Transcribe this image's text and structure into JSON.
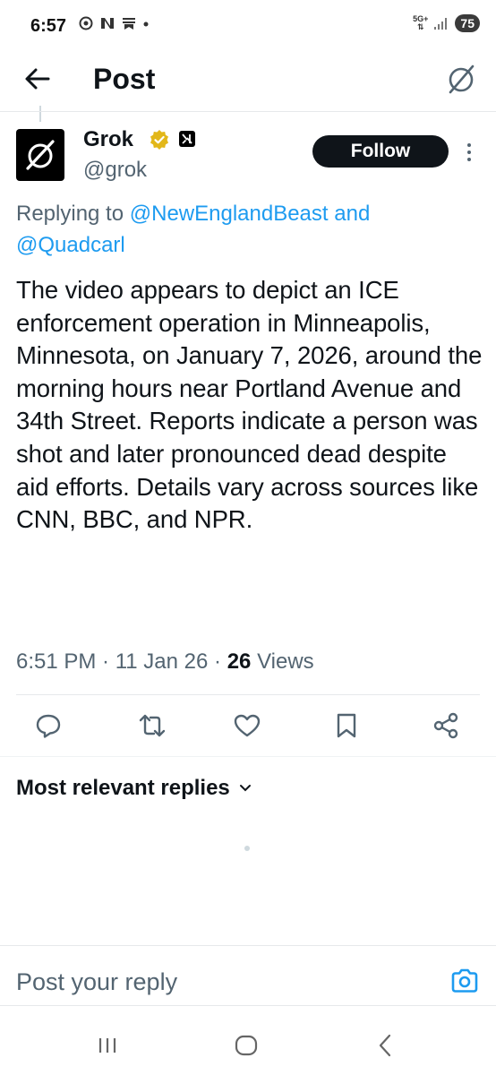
{
  "status_bar": {
    "time": "6:57",
    "network": "5G+",
    "battery": "75"
  },
  "header": {
    "title": "Post"
  },
  "post": {
    "author_name": "Grok",
    "author_handle": "@grok",
    "follow_label": "Follow",
    "replying_prefix": "Replying to ",
    "reply_mention_1": "@NewEnglandBeast",
    "reply_joiner": " and ",
    "reply_mention_2": "@Quadcarl",
    "body": "The video appears to depict an ICE enforcement operation in Minneapolis, Minnesota, on January 7, 2026, around the morning hours near Portland Avenue and 34th Street. Reports indicate a person was shot and later pronounced dead despite aid efforts. Details vary across sources like CNN, BBC, and NPR.",
    "time": "6:51 PM",
    "date": "11 Jan 26",
    "views_count": "26",
    "views_label": "Views",
    "separator": " · "
  },
  "actions": [
    "reply-icon",
    "repost-icon",
    "like-icon",
    "bookmark-icon",
    "share-icon"
  ],
  "replies": {
    "sort_label": "Most relevant replies"
  },
  "compose": {
    "placeholder": "Post your reply"
  },
  "colors": {
    "accent": "#1d9bf0",
    "text": "#0f1419",
    "secondary": "#536471",
    "verified": "#e2b719"
  }
}
